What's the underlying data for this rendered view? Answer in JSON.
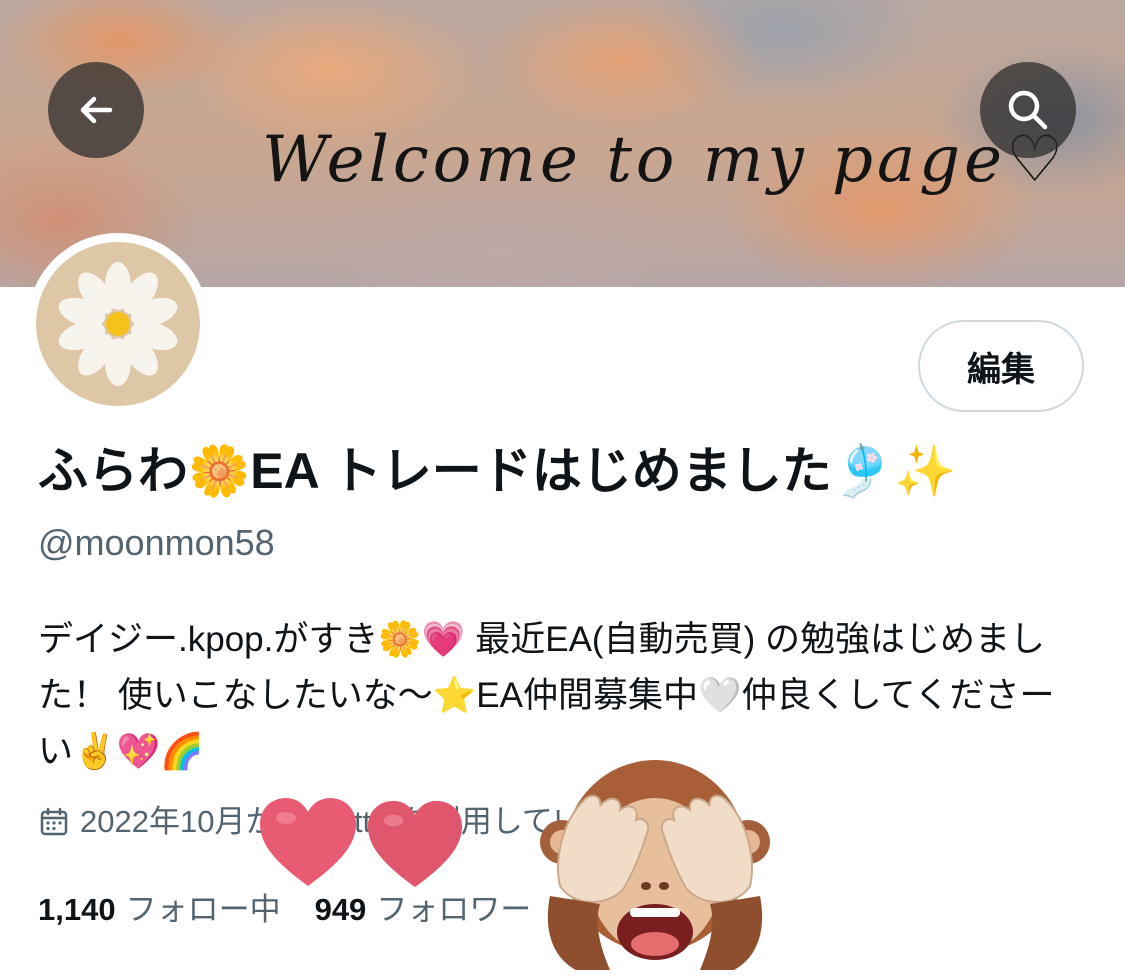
{
  "header": {
    "banner_text": "Welcome to my page♡",
    "back_icon": "arrow-left-icon",
    "search_icon": "search-icon"
  },
  "profile": {
    "edit_label": "編集",
    "display_name": "ふらわ🌼EA トレードはじめました🎐✨",
    "handle": "@moonmon58",
    "bio": "デイジー.kpop.がすき🌼💗 最近EA(自動売買) の勉強はじめました！ 使いこなしたいな〜⭐EA仲間募集中🤍仲良くしてくださーい✌️💖🌈",
    "joined_icon": "calendar-icon",
    "joined_text": "2022年10月からTwitterを利用しています",
    "following_count": "1,140",
    "following_label": "フォロー中",
    "followers_count": "949",
    "followers_label": "フォロワー"
  },
  "stickers": {
    "hearts_icon": "heart-sticker-icon",
    "monkey_icon": "see-no-evil-monkey-icon"
  },
  "colors": {
    "text_primary": "#0f1419",
    "text_secondary": "#536471",
    "button_border": "#cfd9de",
    "heart": "#e85b73",
    "avatar_bg": "#ddc7a7"
  }
}
